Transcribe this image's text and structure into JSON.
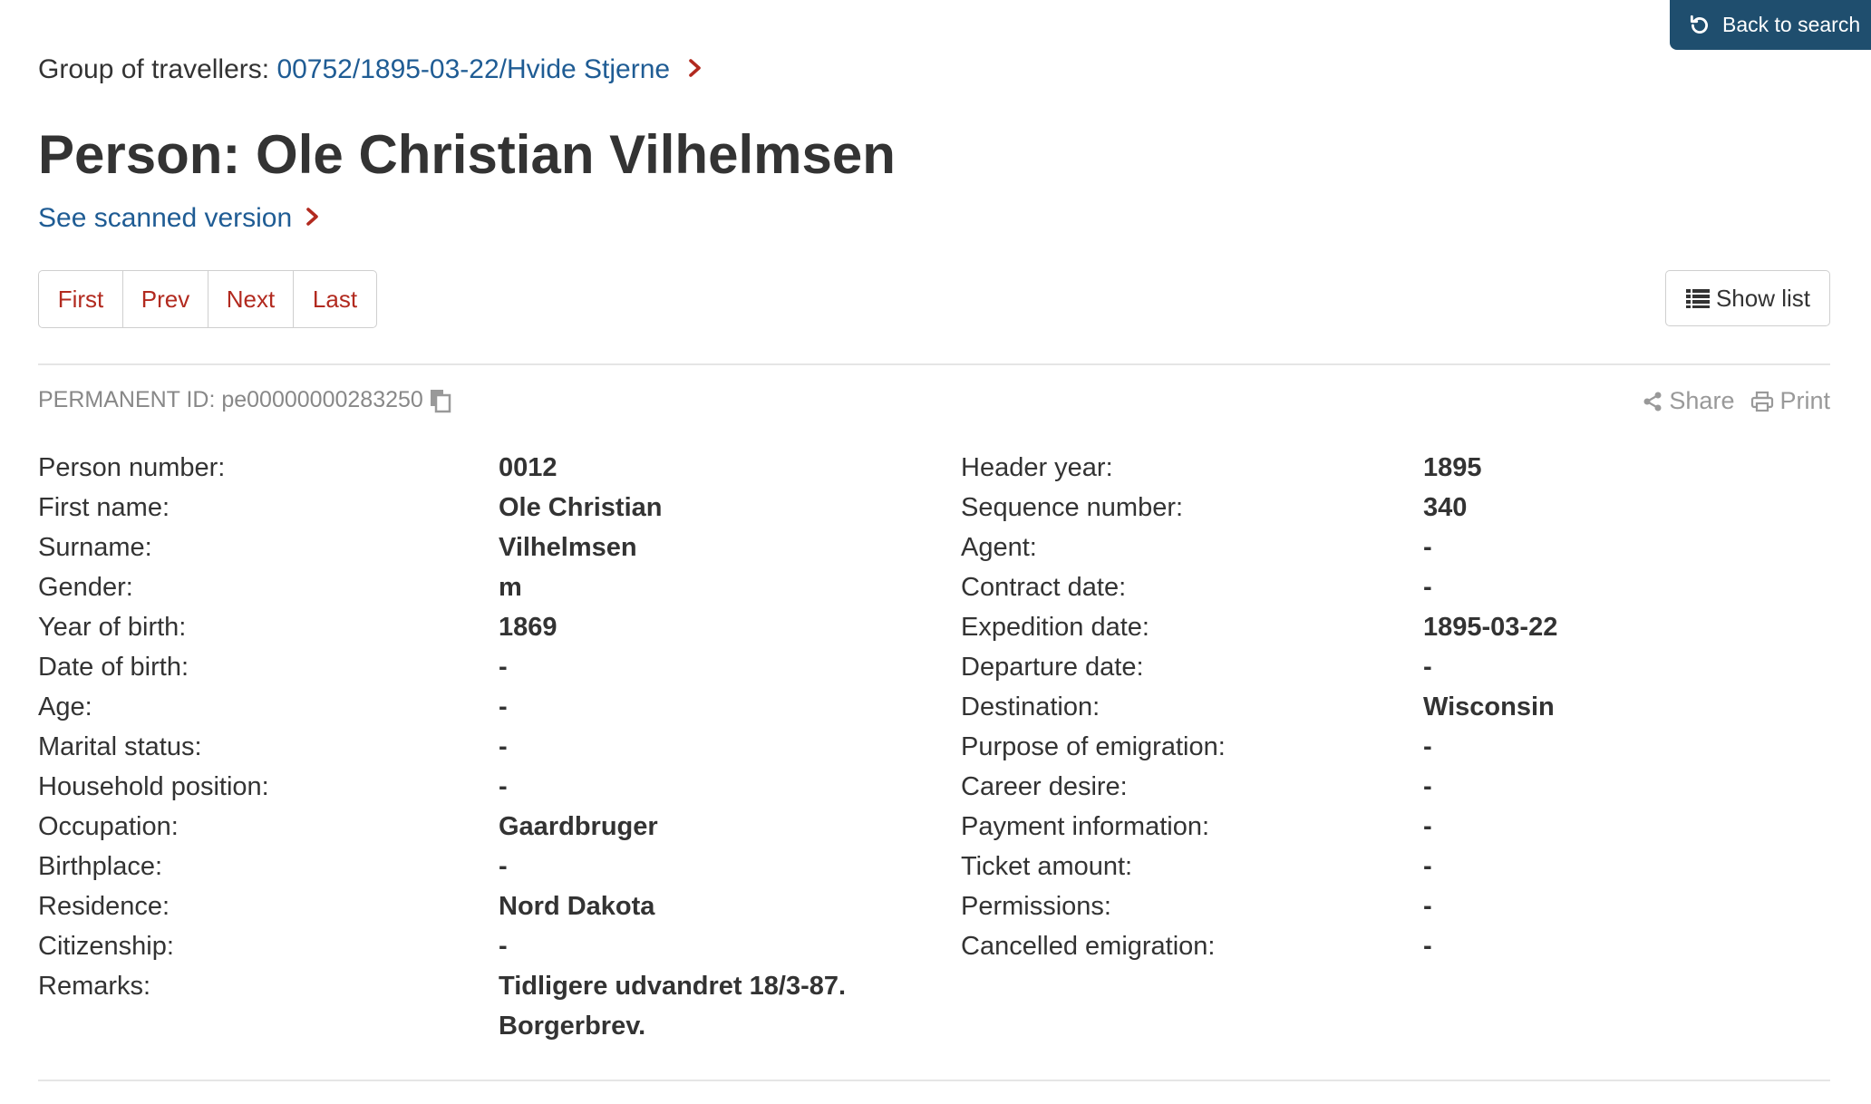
{
  "back_to_search": "Back to search",
  "group": {
    "label": "Group of travellers: ",
    "link": "00752/1895-03-22/Hvide Stjerne",
    "chevron": "›"
  },
  "title": "Person: Ole Christian Vilhelmsen",
  "scan_link": "See scanned version",
  "scan_chevron": "›",
  "pager": {
    "first": "First",
    "prev": "Prev",
    "next": "Next",
    "last": "Last"
  },
  "show_list": "Show list",
  "permanent_id": "PERMANENT ID: pe00000000283250",
  "actions": {
    "share": "Share",
    "print": "Print"
  },
  "left_fields": [
    {
      "label": "Person number:",
      "value": "0012"
    },
    {
      "label": "First name:",
      "value": "Ole Christian"
    },
    {
      "label": "Surname:",
      "value": "Vilhelmsen"
    },
    {
      "label": "Gender:",
      "value": "m"
    },
    {
      "label": "Year of birth:",
      "value": "1869"
    },
    {
      "label": "Date of birth:",
      "value": "-"
    },
    {
      "label": "Age:",
      "value": "-"
    },
    {
      "label": "Marital status:",
      "value": "-"
    },
    {
      "label": "Household position:",
      "value": "-"
    },
    {
      "label": "Occupation:",
      "value": "Gaardbruger"
    },
    {
      "label": "Birthplace:",
      "value": "-"
    },
    {
      "label": "Residence:",
      "value": "Nord Dakota"
    },
    {
      "label": "Citizenship:",
      "value": "-"
    },
    {
      "label": "Remarks:",
      "value": "Tidligere udvandret 18/3-87.",
      "value2": "Borgerbrev."
    }
  ],
  "right_fields": [
    {
      "label": "Header year:",
      "value": "1895"
    },
    {
      "label": "Sequence number:",
      "value": "340"
    },
    {
      "label": "Agent:",
      "value": "-"
    },
    {
      "label": "Contract date:",
      "value": "-"
    },
    {
      "label": "Expedition date:",
      "value": "1895-03-22"
    },
    {
      "label": "Departure date:",
      "value": "-"
    },
    {
      "label": "Destination:",
      "value": "Wisconsin"
    },
    {
      "label": "Purpose of emigration:",
      "value": "-"
    },
    {
      "label": "Career desire:",
      "value": "-"
    },
    {
      "label": "Payment information:",
      "value": "-"
    },
    {
      "label": "Ticket amount:",
      "value": "-"
    },
    {
      "label": "Permissions:",
      "value": "-"
    },
    {
      "label": "Cancelled emigration:",
      "value": "-"
    }
  ]
}
